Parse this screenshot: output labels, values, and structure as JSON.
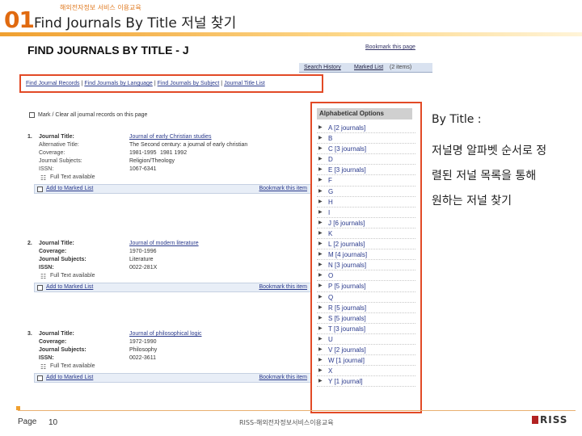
{
  "slide": {
    "number": "01",
    "kicker": "해외전자정보 서비스 이용교육",
    "title": "Find Journals By Title 저널 찾기"
  },
  "web": {
    "page_title": "FIND JOURNALS BY TITLE - J",
    "bookmark_top": "Bookmark this page",
    "toolbar": {
      "search_history": "Search History",
      "marked_list": "Marked List",
      "items": "(2 items)"
    },
    "nav_links": [
      "Find Journal Records",
      "Find Journals by Language",
      "Find Journals by Subject",
      "Journal Title List"
    ],
    "mark_all": "Mark / Clear all journal records on this page",
    "records": [
      {
        "index": "1.",
        "lines": [
          {
            "label": "Journal Title:",
            "value": "Journal of early Christian studies",
            "link": true,
            "strong": true
          },
          {
            "label": "Alternative Title:",
            "value": "The Second century: a journal of early christian",
            "link": false,
            "strong": false
          },
          {
            "label": "Coverage:",
            "value": "1981-1995",
            "link": false,
            "strong": false
          },
          {
            "label": "Journal Subjects:",
            "value": "Religion/Theology",
            "link": false,
            "strong": false
          },
          {
            "label": "ISSN:",
            "value": "1067-6341",
            "link": false,
            "strong": false
          }
        ],
        "alt_extra": "1981 1992",
        "fulltext": "Full Text available",
        "add_marked": "Add to Marked List",
        "bookmark": "Bookmark this item"
      },
      {
        "index": "2.",
        "lines": [
          {
            "label": "Journal Title:",
            "value": "Journal of modern literature",
            "link": true,
            "strong": true
          },
          {
            "label": "Coverage:",
            "value": "1970-1996",
            "link": false,
            "strong": false
          },
          {
            "label": "Journal Subjects:",
            "value": "Literature",
            "link": false,
            "strong": false
          },
          {
            "label": "ISSN:",
            "value": "0022-281X",
            "link": false,
            "strong": false
          }
        ],
        "fulltext": "Full Text available",
        "add_marked": "Add to Marked List",
        "bookmark": "Bookmark this item"
      },
      {
        "index": "3.",
        "lines": [
          {
            "label": "Journal Title:",
            "value": "Journal of philosophical logic",
            "link": true,
            "strong": true
          },
          {
            "label": "Coverage:",
            "value": "1972-1990",
            "link": false,
            "strong": false
          },
          {
            "label": "Journal Subjects:",
            "value": "Philosophy",
            "link": false,
            "strong": false
          },
          {
            "label": "ISSN:",
            "value": "0022-3611",
            "link": false,
            "strong": false
          }
        ],
        "fulltext": "Full Text available",
        "add_marked": "Add to Marked List",
        "bookmark": "Bookmark this item"
      }
    ],
    "alpha_head": "Alphabetical Options",
    "alpha_items": [
      {
        "letter": "A",
        "count": "[2 journals]"
      },
      {
        "letter": "B",
        "count": ""
      },
      {
        "letter": "C",
        "count": "[3 journals]"
      },
      {
        "letter": "D",
        "count": ""
      },
      {
        "letter": "E",
        "count": "[3 journals]"
      },
      {
        "letter": "F",
        "count": ""
      },
      {
        "letter": "G",
        "count": ""
      },
      {
        "letter": "H",
        "count": ""
      },
      {
        "letter": "I",
        "count": ""
      },
      {
        "letter": "J",
        "count": "[6 journals]"
      },
      {
        "letter": "K",
        "count": ""
      },
      {
        "letter": "L",
        "count": "[2 journals]"
      },
      {
        "letter": "M",
        "count": "[4 journals]"
      },
      {
        "letter": "N",
        "count": "[3 journals]"
      },
      {
        "letter": "O",
        "count": ""
      },
      {
        "letter": "P",
        "count": "[5 journals]"
      },
      {
        "letter": "Q",
        "count": ""
      },
      {
        "letter": "R",
        "count": "[5 journals]"
      },
      {
        "letter": "S",
        "count": "[5 journals]"
      },
      {
        "letter": "T",
        "count": "[3 journals]"
      },
      {
        "letter": "U",
        "count": ""
      },
      {
        "letter": "V",
        "count": "[2 journals]"
      },
      {
        "letter": "W",
        "count": "[1 journal]"
      },
      {
        "letter": "X",
        "count": ""
      },
      {
        "letter": "Y",
        "count": "[1 journal]"
      }
    ]
  },
  "description": {
    "title": "By Title :",
    "lines": [
      "저널명 알파벳 순서로 정",
      "렬된 저널 목록을 통해",
      "원하는 저널 찾기"
    ]
  },
  "footer": {
    "page_label": "Page",
    "page_number": "10",
    "center_text": "RISS-해외전자정보서비스이용교육",
    "logo_text": "RISS"
  },
  "colors": {
    "accent": "#e06a10",
    "highlight_border": "#e24a26",
    "link": "#2a3a8c"
  }
}
